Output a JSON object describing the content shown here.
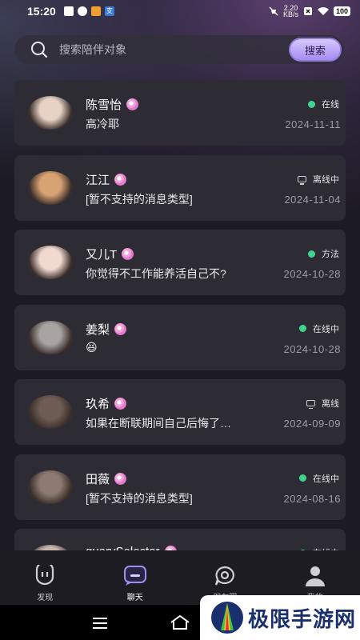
{
  "status_bar": {
    "time": "15:20",
    "speed": "2.20\nKB/s",
    "battery": "100"
  },
  "search": {
    "placeholder": "搜索陪伴对象",
    "button_label": "搜索"
  },
  "chats": [
    {
      "name": "陈雪怡",
      "message": "高冷耶",
      "status": "在线",
      "status_kind": "online",
      "date": "2024-11-11",
      "avatar_color": "#e8d2c6"
    },
    {
      "name": "江江",
      "message": "[暂不支持的消息类型]",
      "status": "离线中",
      "status_kind": "offline",
      "date": "2024-11-04",
      "avatar_color": "#d9a273"
    },
    {
      "name": "又儿T",
      "message": "你觉得不工作能养活自己不?",
      "status": "方法",
      "status_kind": "online",
      "date": "2024-10-28",
      "avatar_color": "#f1d9cf"
    },
    {
      "name": "姜梨",
      "message": "😆",
      "status": "在线中",
      "status_kind": "online",
      "date": "2024-10-28",
      "avatar_color": "#a9a4a2"
    },
    {
      "name": "玖希",
      "message": "如果在断联期间自己后悔了…",
      "status": "离线",
      "status_kind": "offline",
      "date": "2024-09-09",
      "avatar_color": "#6f5d55"
    },
    {
      "name": "田薇",
      "message": "[暂不支持的消息类型]",
      "status": "在线中",
      "status_kind": "online",
      "date": "2024-08-16",
      "avatar_color": "#8d7a72"
    },
    {
      "name": "querySelector",
      "message": "",
      "status": "在线中",
      "status_kind": "online",
      "date": "",
      "avatar_color": "#c9b8b0"
    }
  ],
  "nav": [
    {
      "label": "发现",
      "icon": "discover-icon",
      "active": false
    },
    {
      "label": "聊天",
      "icon": "chat-icon",
      "active": true
    },
    {
      "label": "朋友圈",
      "icon": "moments-icon",
      "active": false
    },
    {
      "label": "我的",
      "icon": "profile-icon",
      "active": false
    }
  ],
  "watermark": {
    "text": "极限手游网"
  },
  "colors": {
    "accent": "#a58cf0",
    "online": "#3fd58f",
    "card": "#2d2b34"
  }
}
